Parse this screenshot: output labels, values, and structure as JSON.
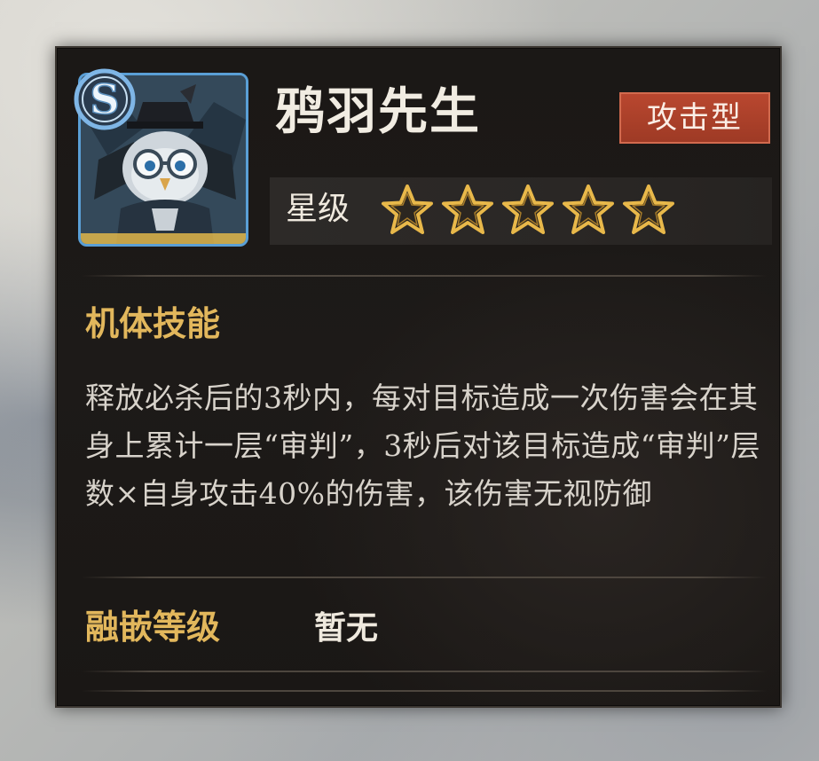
{
  "character": {
    "name": "鸦羽先生",
    "rank": "S",
    "type": "攻击型",
    "star_label": "星级",
    "stars_total": 5,
    "stars_filled": 5
  },
  "skill": {
    "title": "机体技能",
    "description": "释放必杀后的3秒内，每对目标造成一次伤害会在其身上累计一层“审判”，3秒后对该目标造成“审判”层数×自身攻击40%的伤害，该伤害无视防御"
  },
  "fusion": {
    "label": "融嵌等级",
    "value": "暂无"
  },
  "colors": {
    "type_badge": "#b9472f",
    "section_title": "#e2b75c",
    "star_gold": "#e8b84a",
    "portrait_border": "#5a9fd6"
  }
}
